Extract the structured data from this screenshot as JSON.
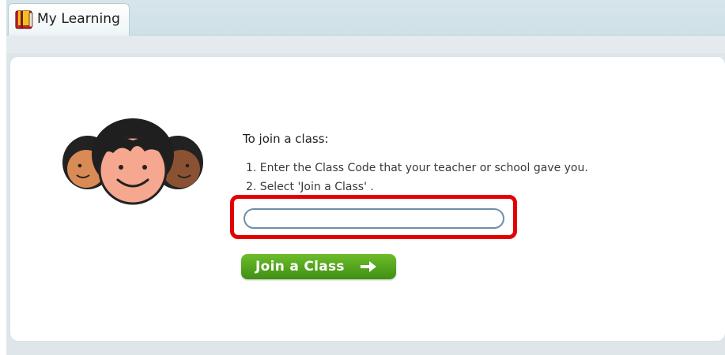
{
  "tab": {
    "label": "My Learning",
    "icon": "book-icon"
  },
  "main": {
    "title": "To join a class:",
    "steps": [
      "1. Enter the Class Code that your teacher or school gave you.",
      "2. Select 'Join a Class' ."
    ],
    "class_code_input": {
      "value": "",
      "placeholder": ""
    },
    "join_button": {
      "label": "Join a Class",
      "icon": "arrow-right-icon"
    },
    "mascot_icon": "kids-faces-icon"
  },
  "colors": {
    "highlight": "#e30000",
    "button": "#4fa21c",
    "input_border": "#6f8fa6"
  }
}
